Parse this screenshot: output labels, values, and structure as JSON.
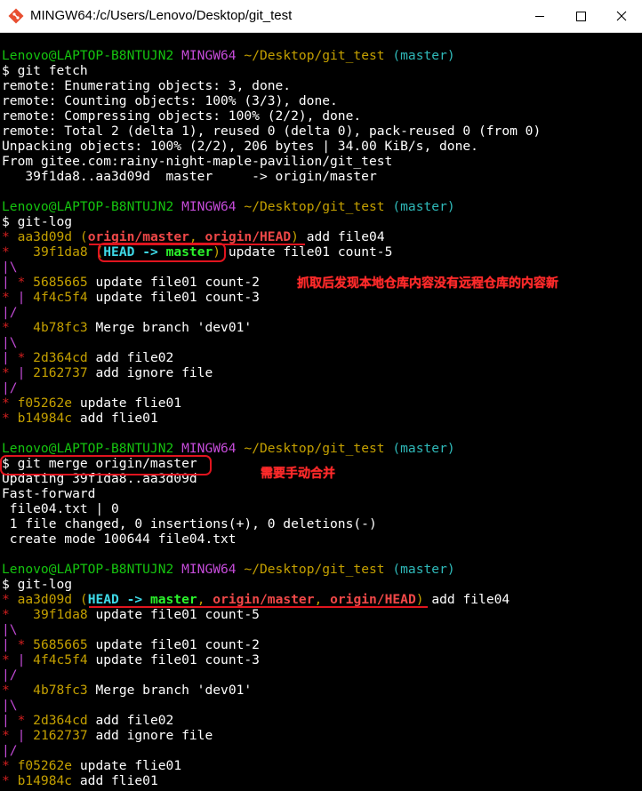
{
  "window": {
    "title": "MINGW64:/c/Users/Lenovo/Desktop/git_test",
    "icons": [
      "git-bash-icon",
      "minimize-icon",
      "maximize-icon",
      "close-icon"
    ]
  },
  "colors": {
    "prompt_user": "#15c40f",
    "prompt_env": "#c44bd8",
    "prompt_path": "#c4a000",
    "prompt_branch": "#2fb9b9",
    "annotation": "#e0141e"
  },
  "prompt": {
    "user_host": "Lenovo@LAPTOP-B8NTUJN2",
    "env": "MINGW64",
    "path": "~/Desktop/git_test",
    "branch": "(master)"
  },
  "fetch_block": {
    "command": "$ git fetch",
    "output": [
      "remote: Enumerating objects: 3, done.",
      "remote: Counting objects: 100% (3/3), done.",
      "remote: Compressing objects: 100% (2/2), done.",
      "remote: Total 2 (delta 1), reused 0 (delta 0), pack-reused 0 (from 0)",
      "Unpacking objects: 100% (2/2), 206 bytes | 34.00 KiB/s, done.",
      "From gitee.com:rainy-night-maple-pavilion/git_test",
      "   39f1da8..aa3d09d  master     -> origin/master"
    ]
  },
  "log1": {
    "command": "$ git-log",
    "l1_graph": "* ",
    "l1_hash": "aa3d09d",
    "l1_open": "(",
    "l1_ref1": "origin/master",
    "l1_sep": ", ",
    "l1_ref2": "origin/HEAD",
    "l1_close": ")",
    "l1_msg": " add file04",
    "l2_graph": "*   ",
    "l2_hash": "39f1da8",
    "l2_open": "(",
    "l2_head": "HEAD -> ",
    "l2_branch": "master",
    "l2_close": ")",
    "l2_msg": " update file01 count-5",
    "l3_graph": "|\\",
    "l4_g1": "| ",
    "l4_g2": "* ",
    "l4_hash": "5685665",
    "l4_msg": " update file01 count-2",
    "l5_g1": "* ",
    "l5_g2": "| ",
    "l5_hash": "4f4c5f4",
    "l5_msg": " update file01 count-3",
    "l6_graph": "|/",
    "l7_graph": "*   ",
    "l7_hash": "4b78fc3",
    "l7_msg": " Merge branch 'dev01'",
    "l8_graph": "|\\",
    "l9_g1": "| ",
    "l9_g2": "* ",
    "l9_hash": "2d364cd",
    "l9_msg": " add file02",
    "l10_g1": "* ",
    "l10_g2": "| ",
    "l10_hash": "2162737",
    "l10_msg": " add ignore file",
    "l11_graph": "|/",
    "l12_graph": "* ",
    "l12_hash": "f05262e",
    "l12_msg": " update flie01",
    "l13_graph": "* ",
    "l13_hash": "b14984c",
    "l13_msg": " add flie01"
  },
  "merge_block": {
    "command": "$ git merge origin/master",
    "output": [
      "Updating 39f1da8..aa3d09d",
      "Fast-forward",
      " file04.txt | 0",
      " 1 file changed, 0 insertions(+), 0 deletions(-)",
      " create mode 100644 file04.txt"
    ]
  },
  "log2": {
    "command": "$ git-log",
    "l1_graph": "* ",
    "l1_hash": "aa3d09d",
    "l1_open": "(",
    "l1_head": "HEAD -> ",
    "l1_branch": "master",
    "l1_sep1": ", ",
    "l1_ref1": "origin/master",
    "l1_sep2": ", ",
    "l1_ref2": "origin/HEAD",
    "l1_close": ")",
    "l1_msg": " add file04",
    "l2_graph": "*   ",
    "l2_hash": "39f1da8",
    "l2_msg": " update file01 count-5",
    "l3_graph": "|\\",
    "l4_g1": "| ",
    "l4_g2": "* ",
    "l4_hash": "5685665",
    "l4_msg": " update file01 count-2",
    "l5_g1": "* ",
    "l5_g2": "| ",
    "l5_hash": "4f4c5f4",
    "l5_msg": " update file01 count-3",
    "l6_graph": "|/",
    "l7_graph": "*   ",
    "l7_hash": "4b78fc3",
    "l7_msg": " Merge branch 'dev01'",
    "l8_graph": "|\\",
    "l9_g1": "| ",
    "l9_g2": "* ",
    "l9_hash": "2d364cd",
    "l9_msg": " add file02",
    "l10_g1": "* ",
    "l10_g2": "| ",
    "l10_hash": "2162737",
    "l10_msg": " add ignore file",
    "l11_graph": "|/",
    "l12_graph": "* ",
    "l12_hash": "f05262e",
    "l12_msg": " update flie01",
    "l13_graph": "* ",
    "l13_hash": "b14984c",
    "l13_msg": " add flie01"
  },
  "annotations": {
    "fetch_note": "抓取后发现本地仓库内容没有远程仓库的内容新",
    "merge_note": "需要手动合并"
  }
}
